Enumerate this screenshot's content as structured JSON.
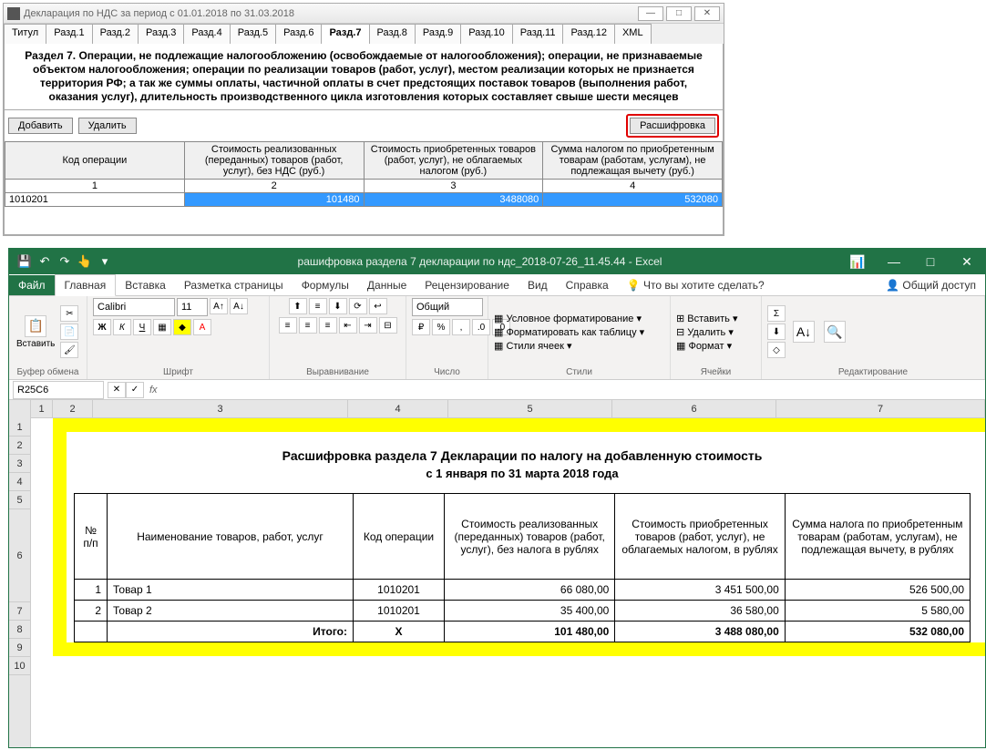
{
  "win1": {
    "title": "Декларация по НДС за период с 01.01.2018 по 31.03.2018",
    "winbtns": {
      "min": "—",
      "max": "□",
      "close": "✕"
    },
    "tabs": [
      "Титул",
      "Разд.1",
      "Разд.2",
      "Разд.3",
      "Разд.4",
      "Разд.5",
      "Разд.6",
      "Разд.7",
      "Разд.8",
      "Разд.9",
      "Разд.10",
      "Разд.11",
      "Разд.12",
      "XML"
    ],
    "active_tab": 7,
    "section_title": "Раздел 7. Операции, не подлежащие налогообложению (освобождаемые от налогообложения); операции, не признаваемые объектом налогообложения; операции по реализации товаров (работ, услуг), местом реализации которых не признается территория РФ; а так же суммы оплаты, частичной оплаты в счет предстоящих поставок товаров (выполнения работ, оказания услуг), длительность производственного цикла изготовления которых составляет свыше шести месяцев",
    "btn_add": "Добавить",
    "btn_del": "Удалить",
    "btn_decode": "Расшифровка",
    "grid": {
      "headers": [
        "Код операции",
        "Стоимость реализованных (переданных) товаров (работ, услуг), без НДС (руб.)",
        "Стоимость приобретенных товаров (работ, услуг), не облагаемых налогом (руб.)",
        "Сумма налогом по приобретенным товарам (работам, услугам), не подлежащая вычету (руб.)"
      ],
      "nums": [
        "1",
        "2",
        "3",
        "4"
      ],
      "row": [
        "1010201",
        "101480",
        "3488080",
        "532080"
      ]
    }
  },
  "excel": {
    "filename": "рашифровка раздела 7 декларации по ндс_2018-07-26_11.45.44  -  Excel",
    "qat": {
      "save": "💾",
      "undo": "↶",
      "redo": "↷",
      "touch": "👆"
    },
    "winbtns": {
      "opts": "📊",
      "min": "—",
      "max": "□",
      "close": "✕"
    },
    "tabs": [
      "Файл",
      "Главная",
      "Вставка",
      "Разметка страницы",
      "Формулы",
      "Данные",
      "Рецензирование",
      "Вид",
      "Справка"
    ],
    "tell_me": "Что вы хотите сделать?",
    "share": "Общий доступ",
    "ribbon": {
      "clipboard": {
        "label": "Буфер обмена",
        "paste": "Вставить"
      },
      "font": {
        "label": "Шрифт",
        "name": "Calibri",
        "size": "11"
      },
      "align": {
        "label": "Выравнивание"
      },
      "number": {
        "label": "Число",
        "format": "Общий"
      },
      "styles": {
        "label": "Стили",
        "cond": "Условное форматирование ▾",
        "tbl": "Форматировать как таблицу ▾",
        "cell": "Стили ячеек ▾"
      },
      "cells": {
        "label": "Ячейки",
        "ins": "Вставить ▾",
        "del": "Удалить ▾",
        "fmt": "Формат ▾"
      },
      "edit": {
        "label": "Редактирование"
      }
    },
    "namebox": "R25C6",
    "cols": [
      "1",
      "2",
      "3",
      "4",
      "5",
      "6",
      "7"
    ],
    "rows": [
      "1",
      "2",
      "3",
      "4",
      "5",
      "6",
      "7",
      "8",
      "9",
      "10"
    ],
    "doc": {
      "title": "Расшифровка раздела 7 Декларации по налогу на добавленную стоимость",
      "subtitle": "с 1 января по 31 марта 2018 года",
      "headers": [
        "№ п/п",
        "Наименование товаров, работ, услуг",
        "Код операции",
        "Стоимость реализованных (переданных) товаров (работ, услуг), без налога в рублях",
        "Стоимость приобретенных товаров (работ, услуг), не облагаемых налогом, в рублях",
        "Сумма налога по приобретенным товарам (работам, услугам), не подлежащая вычету, в рублях"
      ],
      "rows": [
        {
          "n": "1",
          "name": "Товар 1",
          "code": "1010201",
          "v1": "66 080,00",
          "v2": "3 451 500,00",
          "v3": "526 500,00"
        },
        {
          "n": "2",
          "name": "Товар 2",
          "code": "1010201",
          "v1": "35 400,00",
          "v2": "36 580,00",
          "v3": "5 580,00"
        }
      ],
      "total": {
        "label": "Итого:",
        "code": "Х",
        "v1": "101 480,00",
        "v2": "3 488 080,00",
        "v3": "532 080,00"
      }
    }
  }
}
